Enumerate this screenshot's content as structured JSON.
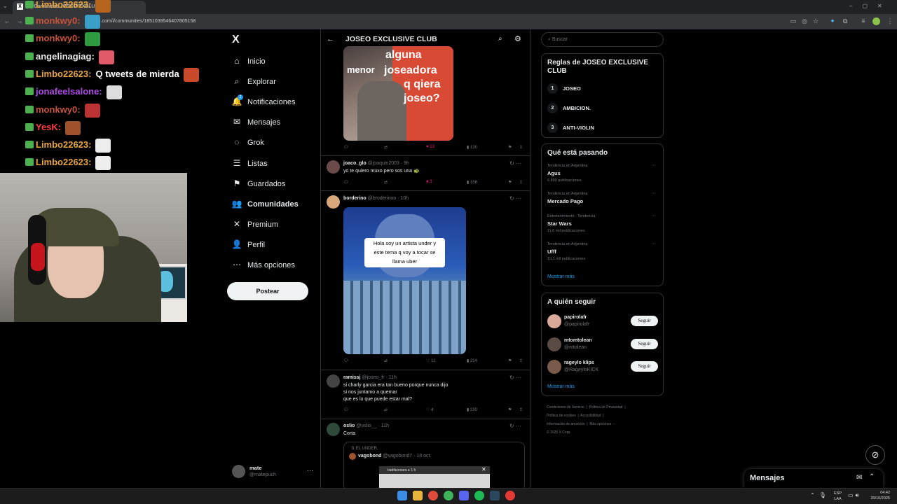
{
  "browser": {
    "tab_title": "(9) Comunidad JOSEO EXCLU...",
    "url": "x.com/i/communities/1851039546407805158"
  },
  "chat": [
    {
      "user": "Limbo22623:",
      "msg": "",
      "color": "#e8a33d"
    },
    {
      "user": "monkwy0:",
      "msg": "",
      "color": "#c9533a"
    },
    {
      "user": "monkwy0:",
      "msg": "",
      "color": "#c9533a"
    },
    {
      "user": "angelinagiag:",
      "msg": "",
      "color": "#e8e8e8"
    },
    {
      "user": "Limbo22623:",
      "msg": "Q tweets de mierda",
      "color": "#e8a33d"
    },
    {
      "user": "jonafeelsalone:",
      "msg": "",
      "color": "#b04ae8"
    },
    {
      "user": "monkwy0:",
      "msg": "",
      "color": "#c9533a"
    },
    {
      "user": "YesK:",
      "msg": "",
      "color": "#ff3d3d"
    },
    {
      "user": "Limbo22623:",
      "msg": "",
      "color": "#e8a33d"
    },
    {
      "user": "Limbo22623:",
      "msg": "",
      "color": "#e8a33d"
    }
  ],
  "sidebar": {
    "logo": "X",
    "items": [
      {
        "label": "Inicio",
        "icon": "home-icon",
        "glyph": "⌂"
      },
      {
        "label": "Explorar",
        "icon": "search-icon",
        "glyph": "⌕"
      },
      {
        "label": "Notificaciones",
        "icon": "bell-icon",
        "glyph": "🔔",
        "badge": "2"
      },
      {
        "label": "Mensajes",
        "icon": "envelope-icon",
        "glyph": "✉"
      },
      {
        "label": "Grok",
        "icon": "grok-icon",
        "glyph": "◌"
      },
      {
        "label": "Listas",
        "icon": "list-icon",
        "glyph": "☰"
      },
      {
        "label": "Guardados",
        "icon": "bookmark-icon",
        "glyph": "⚑"
      },
      {
        "label": "Comunidades",
        "icon": "communities-icon",
        "glyph": "👥",
        "active": true
      },
      {
        "label": "Premium",
        "icon": "x-icon",
        "glyph": "✕"
      },
      {
        "label": "Perfil",
        "icon": "profile-icon",
        "glyph": "👤"
      },
      {
        "label": "Más opciones",
        "icon": "more-icon",
        "glyph": "⋯"
      }
    ],
    "post_label": "Postear",
    "account": {
      "name": "mate",
      "handle": "@matepuch"
    }
  },
  "feed": {
    "header_title": "JOSEO EXCLUSIVE CLUB",
    "tweets": [
      {
        "image_text": [
          "alguna",
          "menor",
          "joseadora",
          "q qiera",
          "joseo?"
        ],
        "likes": "13",
        "views": "130"
      },
      {
        "name": "joaco_glo",
        "handle": "@joaquin2003 · 9h",
        "text": "yo te quiero muxo pero sos una 🐢",
        "likes": "3",
        "views": "156"
      },
      {
        "name": "borderino",
        "handle": "@broderinoo · 10h",
        "image_text": [
          "Hola soy un artista  under y",
          "este tema q voy a tocar se",
          "llama uber"
        ],
        "likes": "11",
        "views": "214"
      },
      {
        "name": "ramissj",
        "handle": "@joseo_fr · 11h",
        "text_lines": [
          "si charly garcia era tan bueno porque nunca dijo",
          "si nos juntamo a quemar",
          "que es lo que puede estar mal?"
        ],
        "likes": "4",
        "views": "230"
      },
      {
        "name": "oslio",
        "handle": "@oslio__ · 11h",
        "text": "Corta",
        "quote": {
          "context": "EL UNDER.",
          "name": "vagobond",
          "handle": "@vagobond7 · 18 oct.",
          "inner": "badfacesara ●  1 h"
        }
      }
    ]
  },
  "right": {
    "search_placeholder": "Buscar",
    "rules_title": "Reglas de JOSEO EXCLUSIVE CLUB",
    "rules": [
      {
        "n": "1",
        "text": "JOSEO"
      },
      {
        "n": "2",
        "text": "AMBICION."
      },
      {
        "n": "3",
        "text": "ANTI-VIOLIN"
      }
    ],
    "trends_title": "Qué está pasando",
    "trends": [
      {
        "context": "Tendencia en Argentina",
        "name": "Agus",
        "count": "6.899 publicaciones"
      },
      {
        "context": "Tendencia en Argentina",
        "name": "Mercado Pago",
        "count": ""
      },
      {
        "context": "Entretenimiento · Tendencia",
        "name": "Star Wars",
        "count": "11,6 mil publicaciones"
      },
      {
        "context": "Tendencia en Argentina",
        "name": "Ufff",
        "count": "13,1 mil publicaciones"
      }
    ],
    "show_more": "Mostrar más",
    "follow_title": "A quién seguir",
    "follow": [
      {
        "name": "papirolafr",
        "handle": "@papirolafr"
      },
      {
        "name": "mtomtolean",
        "handle": "@mtolean"
      },
      {
        "name": "rageylo klips",
        "handle": "@RageyloKICK"
      }
    ],
    "follow_label": "Seguir",
    "footer": [
      "Condiciones de Servicio",
      "Política de Privacidad",
      "Política de cookies",
      "Accesibilidad",
      "Información de anuncios",
      "Más opciones ···",
      "© 2025 X Corp."
    ]
  },
  "messages_drawer": "Mensajes",
  "taskbar": {
    "lang1": "ESP",
    "lang2": "LAA",
    "time": "04:42",
    "date": "20/10/2025"
  }
}
